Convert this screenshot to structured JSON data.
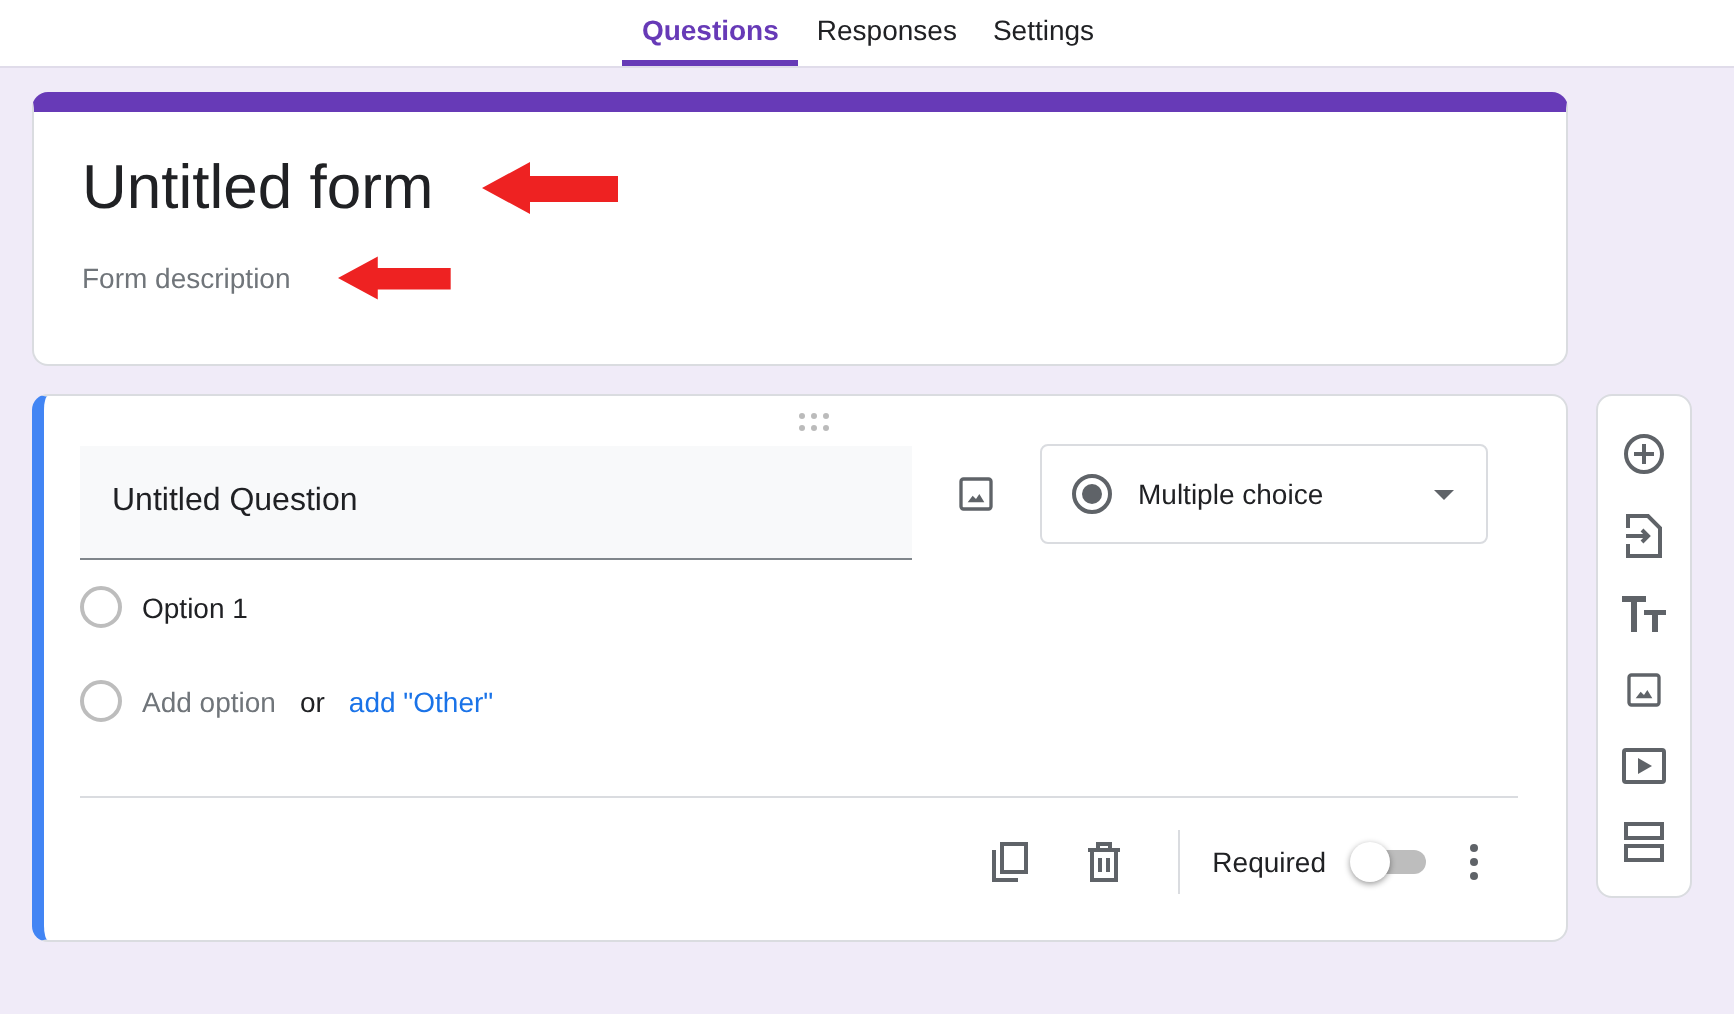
{
  "tabs": [
    {
      "label": "Questions",
      "selected": true
    },
    {
      "label": "Responses",
      "selected": false
    },
    {
      "label": "Settings",
      "selected": false
    }
  ],
  "form": {
    "title": "Untitled form",
    "description": "Form description"
  },
  "question": {
    "title": "Untitled Question",
    "type": "Multiple choice",
    "options": [
      {
        "label": "Option 1",
        "selected": false
      }
    ],
    "add_option": "Add option",
    "add_option_selected": false,
    "or": "or",
    "add_other": "add \"Other\"",
    "required_label": "Required",
    "required": false
  },
  "toolbar": [
    {
      "kind": "add"
    },
    {
      "kind": "import"
    },
    {
      "kind": "title"
    },
    {
      "kind": "image"
    },
    {
      "kind": "video"
    },
    {
      "kind": "section"
    }
  ]
}
